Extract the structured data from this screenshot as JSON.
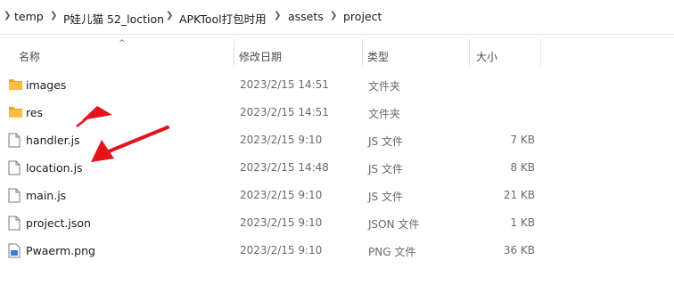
{
  "breadcrumb": {
    "items": [
      "temp",
      "P娃儿猫 52_loction",
      "APKTool打包时用",
      "assets",
      "project"
    ]
  },
  "columns": {
    "name": "名称",
    "modified": "修改日期",
    "type": "类型",
    "size": "大小"
  },
  "files": [
    {
      "name": "images",
      "modified": "2023/2/15 14:51",
      "type": "文件夹",
      "size": "",
      "icon": "folder-icon"
    },
    {
      "name": "res",
      "modified": "2023/2/15 14:51",
      "type": "文件夹",
      "size": "",
      "icon": "folder-icon"
    },
    {
      "name": "handler.js",
      "modified": "2023/2/15 9:10",
      "type": "JS 文件",
      "size": "7 KB",
      "icon": "file-icon"
    },
    {
      "name": "location.js",
      "modified": "2023/2/15 14:48",
      "type": "JS 文件",
      "size": "8 KB",
      "icon": "file-icon"
    },
    {
      "name": "main.js",
      "modified": "2023/2/15 9:10",
      "type": "JS 文件",
      "size": "21 KB",
      "icon": "file-icon"
    },
    {
      "name": "project.json",
      "modified": "2023/2/15 9:10",
      "type": "JSON 文件",
      "size": "1 KB",
      "icon": "file-icon"
    },
    {
      "name": "Pwaerm.png",
      "modified": "2023/2/15 9:10",
      "type": "PNG 文件",
      "size": "36 KB",
      "icon": "image-file-icon"
    }
  ],
  "colors": {
    "folder": "#f5c042",
    "folder_dark": "#e0a82e",
    "annotation_arrow": "#e3141b",
    "selection": "#cce8ff"
  }
}
